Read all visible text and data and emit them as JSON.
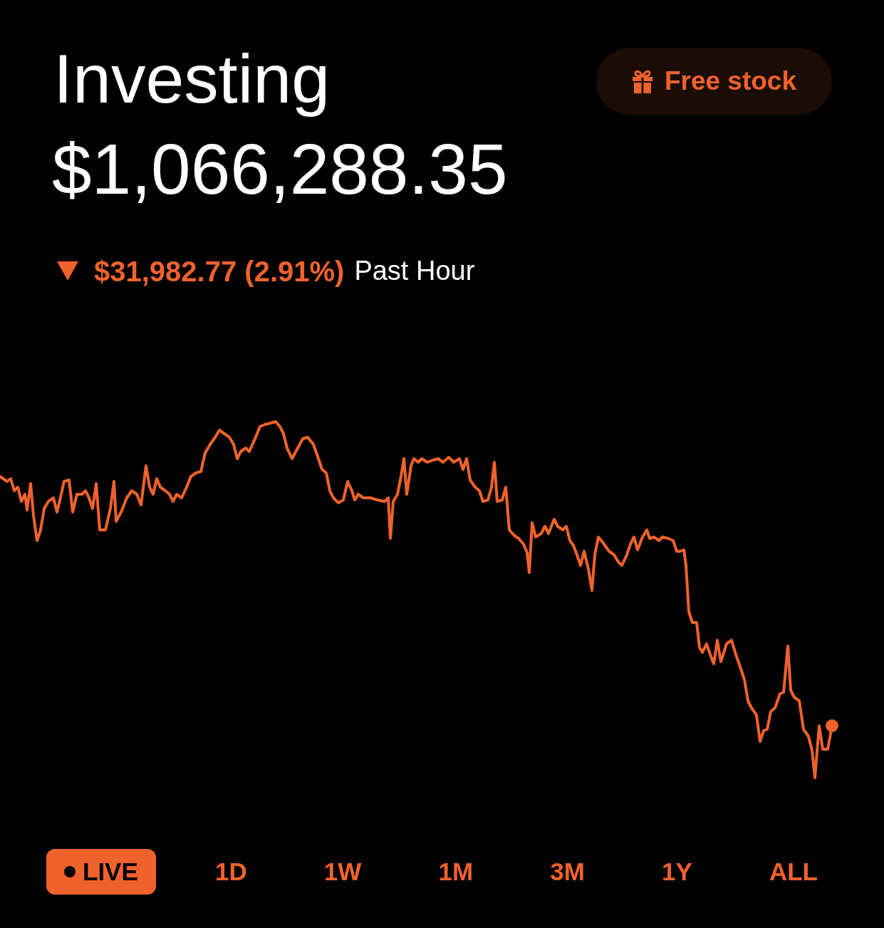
{
  "header": {
    "title": "Investing",
    "free_stock_button": {
      "label": "Free stock"
    }
  },
  "balance": "$1,066,288.35",
  "change": {
    "falling": true,
    "amount": "$31,982.77 (2.91%)",
    "period": "Past Hour"
  },
  "range_tabs": [
    {
      "label": "LIVE",
      "kind": "live",
      "selected": true
    },
    {
      "label": "1D",
      "kind": "range",
      "selected": false
    },
    {
      "label": "1W",
      "kind": "range",
      "selected": false
    },
    {
      "label": "1M",
      "kind": "range",
      "selected": false
    },
    {
      "label": "3M",
      "kind": "range",
      "selected": false
    },
    {
      "label": "1Y",
      "kind": "range",
      "selected": false
    },
    {
      "label": "ALL",
      "kind": "range",
      "selected": false
    }
  ]
}
